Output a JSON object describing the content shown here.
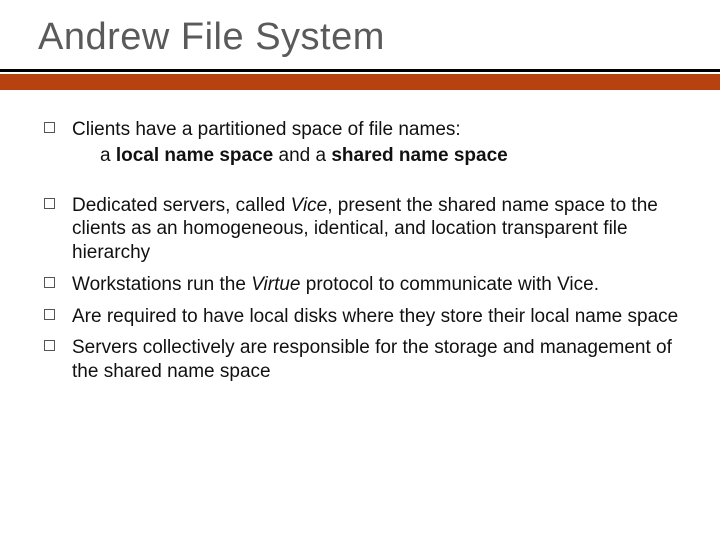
{
  "title": "Andrew File System",
  "bullets": [
    {
      "html": "Clients have a partitioned space of file names:<span class=\"subline\">a <b>local name space</b> and a <b>shared name space</b></span>",
      "gap_after": true
    },
    {
      "html": "Dedicated servers, called <i>Vice</i>, present the shared name space to the clients as an homogeneous, identical, and location transparent file hierarchy"
    },
    {
      "html": "Workstations run the <i>Virtue</i> protocol to communicate with Vice."
    },
    {
      "html": "Are required to have local disks where they store their local name space"
    },
    {
      "html": "Servers collectively are responsible for the storage and management of the shared name space"
    }
  ]
}
